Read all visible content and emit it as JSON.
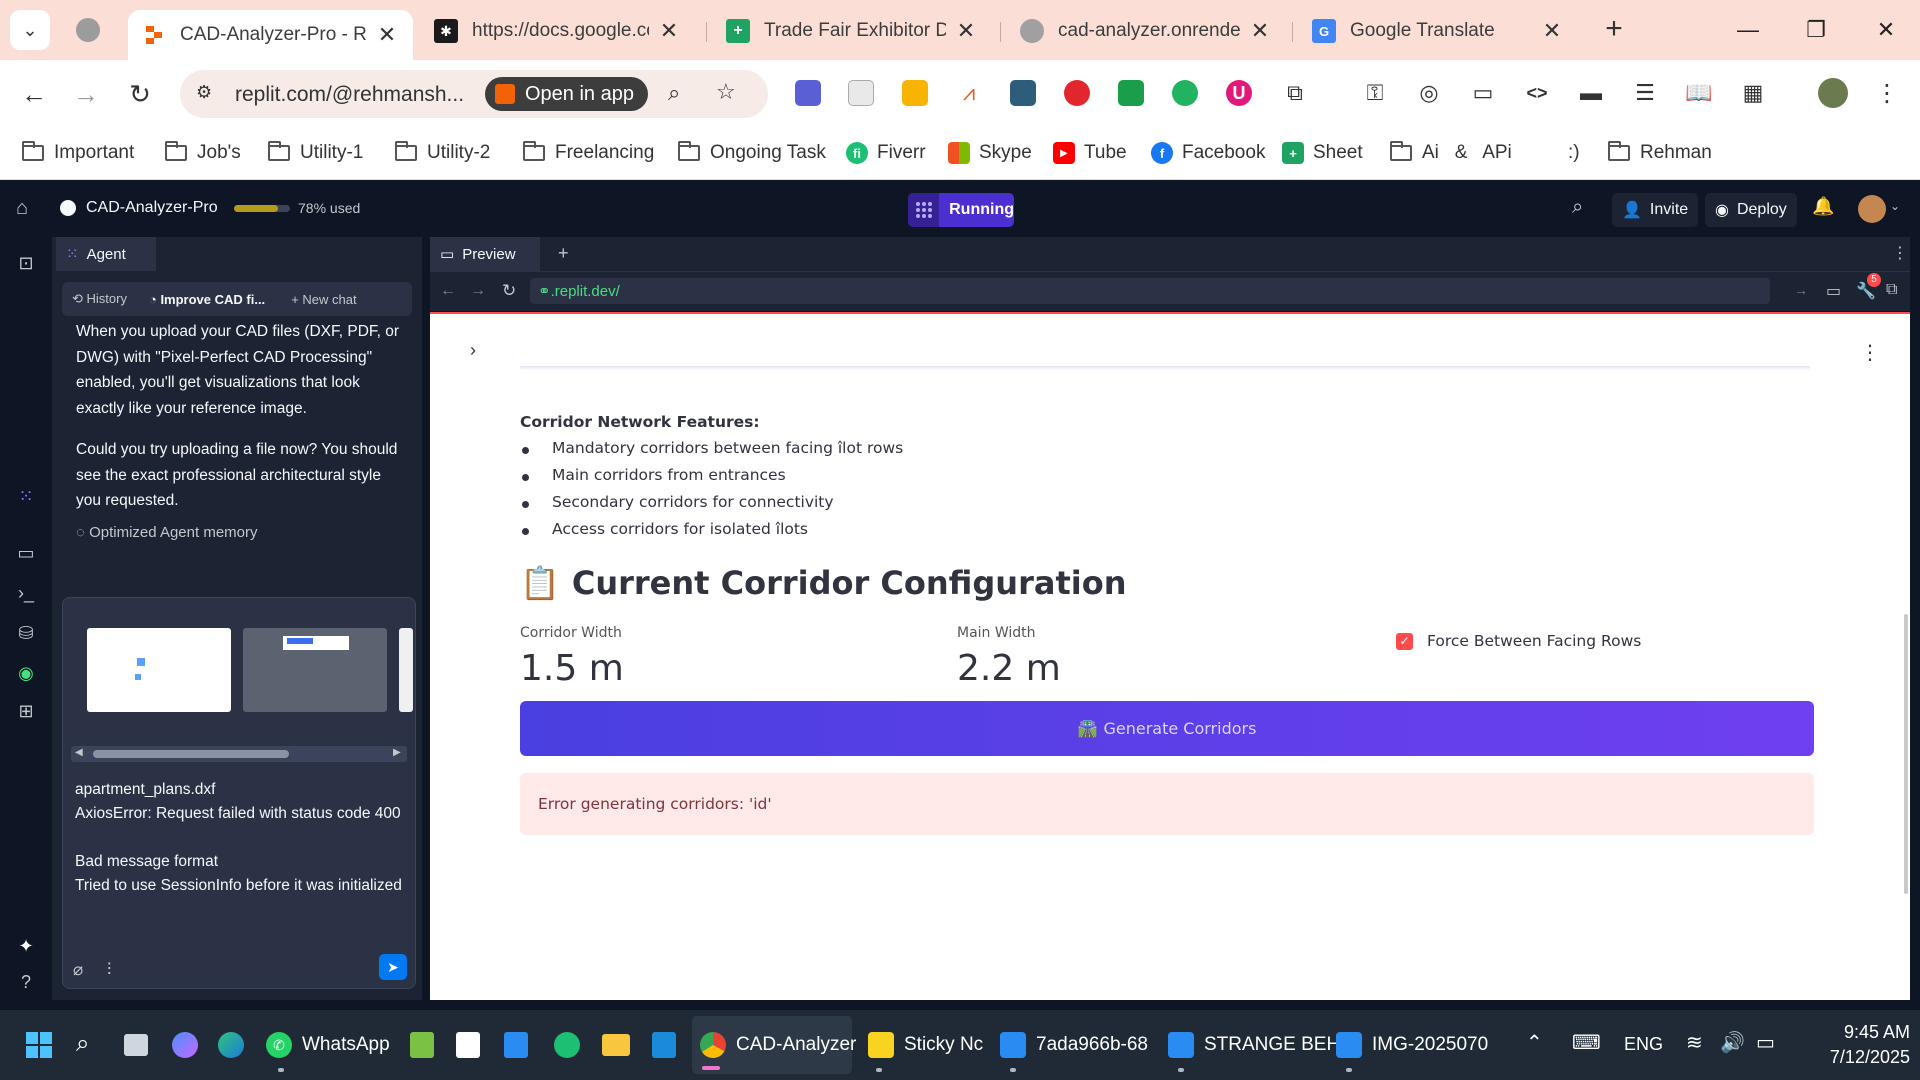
{
  "browser": {
    "tabs": [
      {
        "title": "CAD-Analyzer-Pro - Rep",
        "icon": "replit-icon",
        "active": true
      },
      {
        "title": "https://docs.google.com",
        "icon": "docs-icon",
        "active": false
      },
      {
        "title": "Trade Fair Exhibitor Dat",
        "icon": "sheets-icon",
        "active": false
      },
      {
        "title": "cad-analyzer.onrender.c",
        "icon": "globe-icon",
        "active": false
      },
      {
        "title": "Google Translate",
        "icon": "translate-icon",
        "active": false
      }
    ],
    "new_tab_label": "+",
    "omnibox_url": "replit.com/@rehmansh...",
    "open_in_app_label": "Open in app",
    "bookmarks": [
      "Important",
      "Job's",
      "Utility-1",
      "Utility-2",
      "Freelancing",
      "Ongoing Task",
      "Fiverr",
      "Skype",
      "Tube",
      "Facebook",
      "Sheet",
      "Ai   &   APi",
      ":)",
      "Rehman"
    ]
  },
  "replit": {
    "project_name": "CAD-Analyzer-Pro",
    "usage_text": "78% used",
    "usage_fraction": 0.78,
    "run_status": "Running",
    "invite_label": "Invite",
    "deploy_label": "Deploy",
    "agent_tab_label": "Agent",
    "history_label": "History",
    "chat_title": "Improve CAD fi...",
    "new_chat_label": "New chat",
    "agent_messages": [
      "When you upload your CAD files (DXF, PDF, or DWG) with \"Pixel-Perfect CAD Processing\" enabled, you'll get visualizations that look exactly like your reference image.",
      "Could you try uploading a file now? You should see the exact professional architectural style you requested."
    ],
    "memory_note": "Optimized Agent memory",
    "composer_text": [
      "apartment_plans.dxf",
      "AxiosError: Request failed with status code 400",
      "",
      "Bad message format",
      "Tried to use SessionInfo before it was initialized"
    ],
    "preview_tab_label": "Preview",
    "preview_url": ".replit.dev/",
    "devtools_badge": "5"
  },
  "app": {
    "features_heading": "Corridor Network Features:",
    "features": [
      "Mandatory corridors between facing îlot rows",
      "Main corridors from entrances",
      "Secondary corridors for connectivity",
      "Access corridors for isolated îlots"
    ],
    "config_icon": "📋",
    "config_heading": "Current Corridor Configuration",
    "metrics": [
      {
        "label": "Corridor Width",
        "value": "1.5 m"
      },
      {
        "label": "Main Width",
        "value": "2.2 m"
      }
    ],
    "checkbox_label": "Force Between Facing Rows",
    "checkbox_checked": true,
    "generate_icon": "🛣️",
    "generate_label": "Generate Corridors",
    "error_text": "Error generating corridors: 'id'"
  },
  "taskbar": {
    "items": [
      "WhatsApp",
      "CAD-Analyzer",
      "Sticky Nc",
      "7ada966b-68",
      "STRANGE BEH",
      "IMG-2025070"
    ],
    "language": "ENG",
    "time": "9:45 AM",
    "date": "7/12/2025"
  },
  "colors": {
    "accent": "#4b2fd1",
    "error_bg": "#ffe9e9",
    "button_gradient_start": "#4a3fe0",
    "button_gradient_end": "#6f3ff0",
    "checkbox": "#ff4b4b"
  }
}
